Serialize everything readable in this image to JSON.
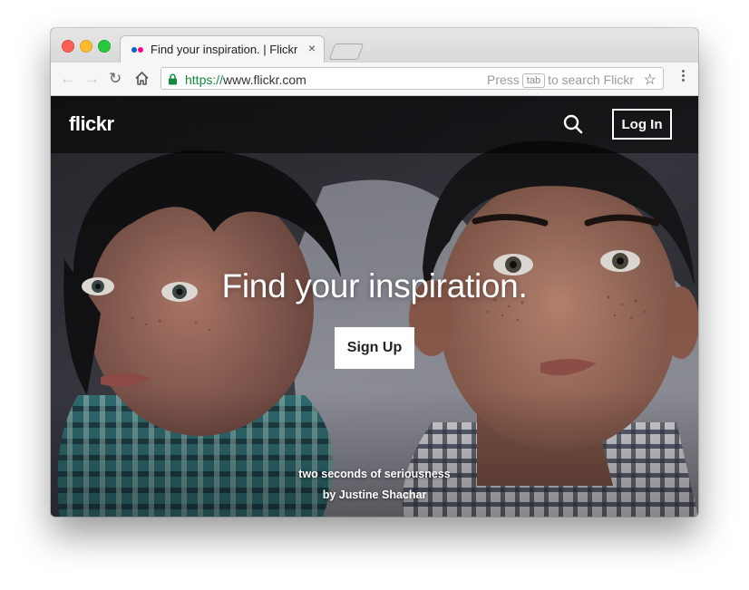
{
  "browser": {
    "tab": {
      "title": "Find your inspiration. | Flickr",
      "close_glyph": "×",
      "favicon_colors": [
        "#0063dc",
        "#ff0084"
      ]
    },
    "toolbar": {
      "back_glyph": "←",
      "forward_glyph": "→",
      "reload_glyph": "↻",
      "url_scheme": "https://",
      "url_host": "www.flickr.com",
      "hint_before": "Press",
      "hint_key": "tab",
      "hint_after": "to search Flickr",
      "star_glyph": "☆"
    }
  },
  "site": {
    "logo": "flickr",
    "login_label": "Log In",
    "headline": "Find your inspiration.",
    "signup_label": "Sign Up",
    "photo_title": "two seconds of seriousness",
    "photo_author": "by Justine Shachar"
  },
  "colors": {
    "secure_green": "#128c3c",
    "header_overlay": "rgba(0,0,0,0.55)",
    "white": "#ffffff"
  },
  "icons": [
    "lock-icon",
    "search-icon",
    "home-icon",
    "star-icon",
    "menu-icon",
    "flickr-favicon"
  ]
}
